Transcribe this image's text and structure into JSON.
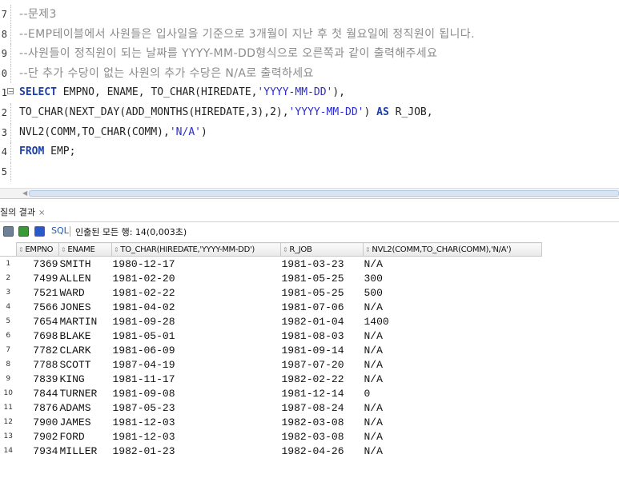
{
  "editor": {
    "lines": [
      {
        "no": "7",
        "fold": false,
        "segments": [
          {
            "t": "--문제3",
            "c": "comment"
          }
        ]
      },
      {
        "no": "8",
        "fold": false,
        "segments": [
          {
            "t": "--EMP테이블에서 사원들은 입사일을 기준으로 3개월이 지난 후 첫 월요일에 정직원이 됩니다.",
            "c": "comment"
          }
        ]
      },
      {
        "no": "9",
        "fold": false,
        "segments": [
          {
            "t": "--사원들이 정직원이 되는 날짜를 YYYY-MM-DD형식으로 오른쪽과 같이 출력해주세요",
            "c": "comment"
          }
        ]
      },
      {
        "no": "0",
        "fold": false,
        "segments": [
          {
            "t": "--단 추가 수당이 없는 사원의 추가 수당은 N/A로 출력하세요",
            "c": "comment"
          }
        ]
      },
      {
        "no": "1",
        "fold": true,
        "segments": [
          {
            "t": "SELECT",
            "c": "kw"
          },
          {
            "t": " EMPNO, ENAME, TO_CHAR(HIREDATE,",
            "c": ""
          },
          {
            "t": "'YYYY-MM-DD'",
            "c": "str"
          },
          {
            "t": "),",
            "c": ""
          }
        ]
      },
      {
        "no": "2",
        "fold": false,
        "segments": [
          {
            "t": "TO_CHAR(NEXT_DAY(ADD_MONTHS(HIREDATE,3),2),",
            "c": ""
          },
          {
            "t": "'YYYY-MM-DD'",
            "c": "str"
          },
          {
            "t": ") ",
            "c": ""
          },
          {
            "t": "AS",
            "c": "kw"
          },
          {
            "t": " R_JOB,",
            "c": ""
          }
        ]
      },
      {
        "no": "3",
        "fold": false,
        "segments": [
          {
            "t": "NVL2(COMM,TO_CHAR(COMM),",
            "c": ""
          },
          {
            "t": "'N/A'",
            "c": "str"
          },
          {
            "t": ")",
            "c": ""
          }
        ]
      },
      {
        "no": "4",
        "fold": false,
        "segments": [
          {
            "t": "FROM",
            "c": "kw"
          },
          {
            "t": " EMP;",
            "c": ""
          }
        ]
      },
      {
        "no": "5",
        "fold": false,
        "segments": []
      }
    ]
  },
  "results": {
    "tab_label": "질의 결과",
    "tab_close": "×",
    "toolbar": {
      "icons": [
        "pin-icon",
        "refresh-icon",
        "cancel-query-icon"
      ],
      "sql_label": "SQL",
      "status": "인출된 모든 행: 14(0,003초)"
    },
    "columns": [
      "EMPNO",
      "ENAME",
      "TO_CHAR(HIREDATE,'YYYY-MM-DD')",
      "R_JOB",
      "NVL2(COMM,TO_CHAR(COMM),'N/A')"
    ],
    "rows": [
      [
        "1",
        "7369",
        "SMITH",
        "1980-12-17",
        "1981-03-23",
        "N/A"
      ],
      [
        "2",
        "7499",
        "ALLEN",
        "1981-02-20",
        "1981-05-25",
        "300"
      ],
      [
        "3",
        "7521",
        "WARD",
        "1981-02-22",
        "1981-05-25",
        "500"
      ],
      [
        "4",
        "7566",
        "JONES",
        "1981-04-02",
        "1981-07-06",
        "N/A"
      ],
      [
        "5",
        "7654",
        "MARTIN",
        "1981-09-28",
        "1982-01-04",
        "1400"
      ],
      [
        "6",
        "7698",
        "BLAKE",
        "1981-05-01",
        "1981-08-03",
        "N/A"
      ],
      [
        "7",
        "7782",
        "CLARK",
        "1981-06-09",
        "1981-09-14",
        "N/A"
      ],
      [
        "8",
        "7788",
        "SCOTT",
        "1987-04-19",
        "1987-07-20",
        "N/A"
      ],
      [
        "9",
        "7839",
        "KING",
        "1981-11-17",
        "1982-02-22",
        "N/A"
      ],
      [
        "10",
        "7844",
        "TURNER",
        "1981-09-08",
        "1981-12-14",
        "0"
      ],
      [
        "11",
        "7876",
        "ADAMS",
        "1987-05-23",
        "1987-08-24",
        "N/A"
      ],
      [
        "12",
        "7900",
        "JAMES",
        "1981-12-03",
        "1982-03-08",
        "N/A"
      ],
      [
        "13",
        "7902",
        "FORD",
        "1981-12-03",
        "1982-03-08",
        "N/A"
      ],
      [
        "14",
        "7934",
        "MILLER",
        "1982-01-23",
        "1982-04-26",
        "N/A"
      ]
    ]
  },
  "colors": {
    "keyword": "#1a3faa",
    "string": "#2b2bd0",
    "comment": "#8c8c8c"
  }
}
